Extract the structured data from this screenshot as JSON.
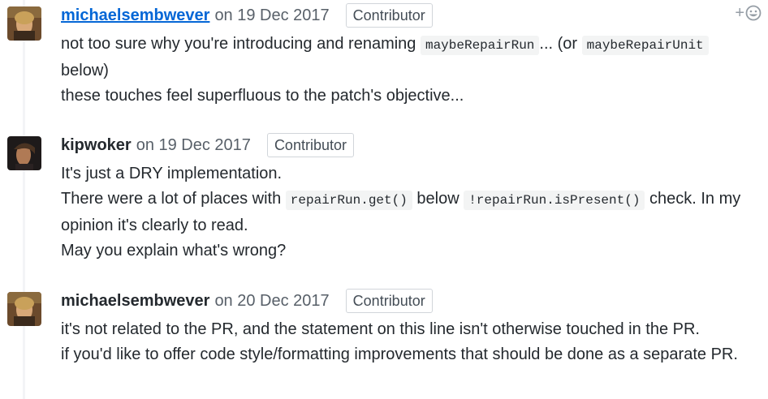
{
  "comments": [
    {
      "author": "michaelsembwever",
      "date": "on 19 Dec 2017",
      "badge": "Contributor",
      "line1_a": "not too sure why you're introducing and renaming ",
      "code1": "maybeRepairRun",
      "line1_b": "... (or ",
      "code2": "maybeRepairUnit",
      "line1_c": " below)",
      "line2": "these touches feel superfluous to the patch's objective..."
    },
    {
      "author": "kipwoker",
      "date": "on 19 Dec 2017",
      "badge": "Contributor",
      "line1": "It's just a DRY implementation.",
      "line2_a": "There were a lot of places with ",
      "code1": "repairRun.get()",
      "line2_b": " below ",
      "code2": "!repairRun.isPresent()",
      "line2_c": " check. In my opinion it's clearly to read.",
      "line3": "May you explain what's wrong?"
    },
    {
      "author": "michaelsembwever",
      "date": "on 20 Dec 2017",
      "badge": "Contributor",
      "line1": "it's not related to the PR, and the statement on this line isn't otherwise touched in the PR.",
      "line2": "if you'd like to offer code style/formatting improvements that should be done as a separate PR."
    }
  ],
  "reaction": {
    "plus": "+",
    "icon": "smiley-icon"
  }
}
